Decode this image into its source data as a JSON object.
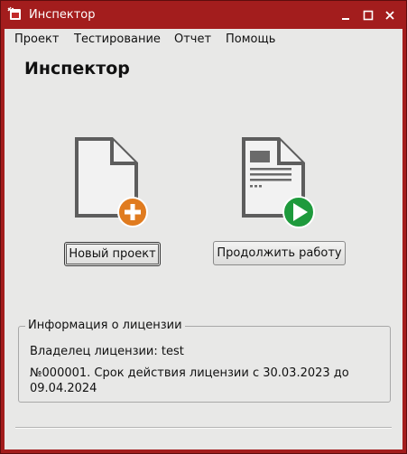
{
  "window": {
    "title": "Инспектор",
    "controls": [
      "minimize",
      "maximize",
      "close"
    ]
  },
  "menu": [
    "Проект",
    "Тестирование",
    "Отчет",
    "Помощь"
  ],
  "heading": "Инспектор",
  "actions": {
    "new_project": {
      "label": "Новый проект",
      "icon": "new-document-plus-icon",
      "accent": "#e07b1f"
    },
    "continue_work": {
      "label": "Продолжить работу",
      "icon": "document-play-icon",
      "accent": "#1e9a3c"
    }
  },
  "license": {
    "title": "Информация о лицензии",
    "owner": "Владелец лицензии: test",
    "number_line_1": "№000001. Срок действия лицензии с 30.03.2023 до",
    "number_line_2": "09.04.2024"
  },
  "colors": {
    "titlebar": "#a31d1d",
    "client_bg": "#e8e8e7"
  }
}
